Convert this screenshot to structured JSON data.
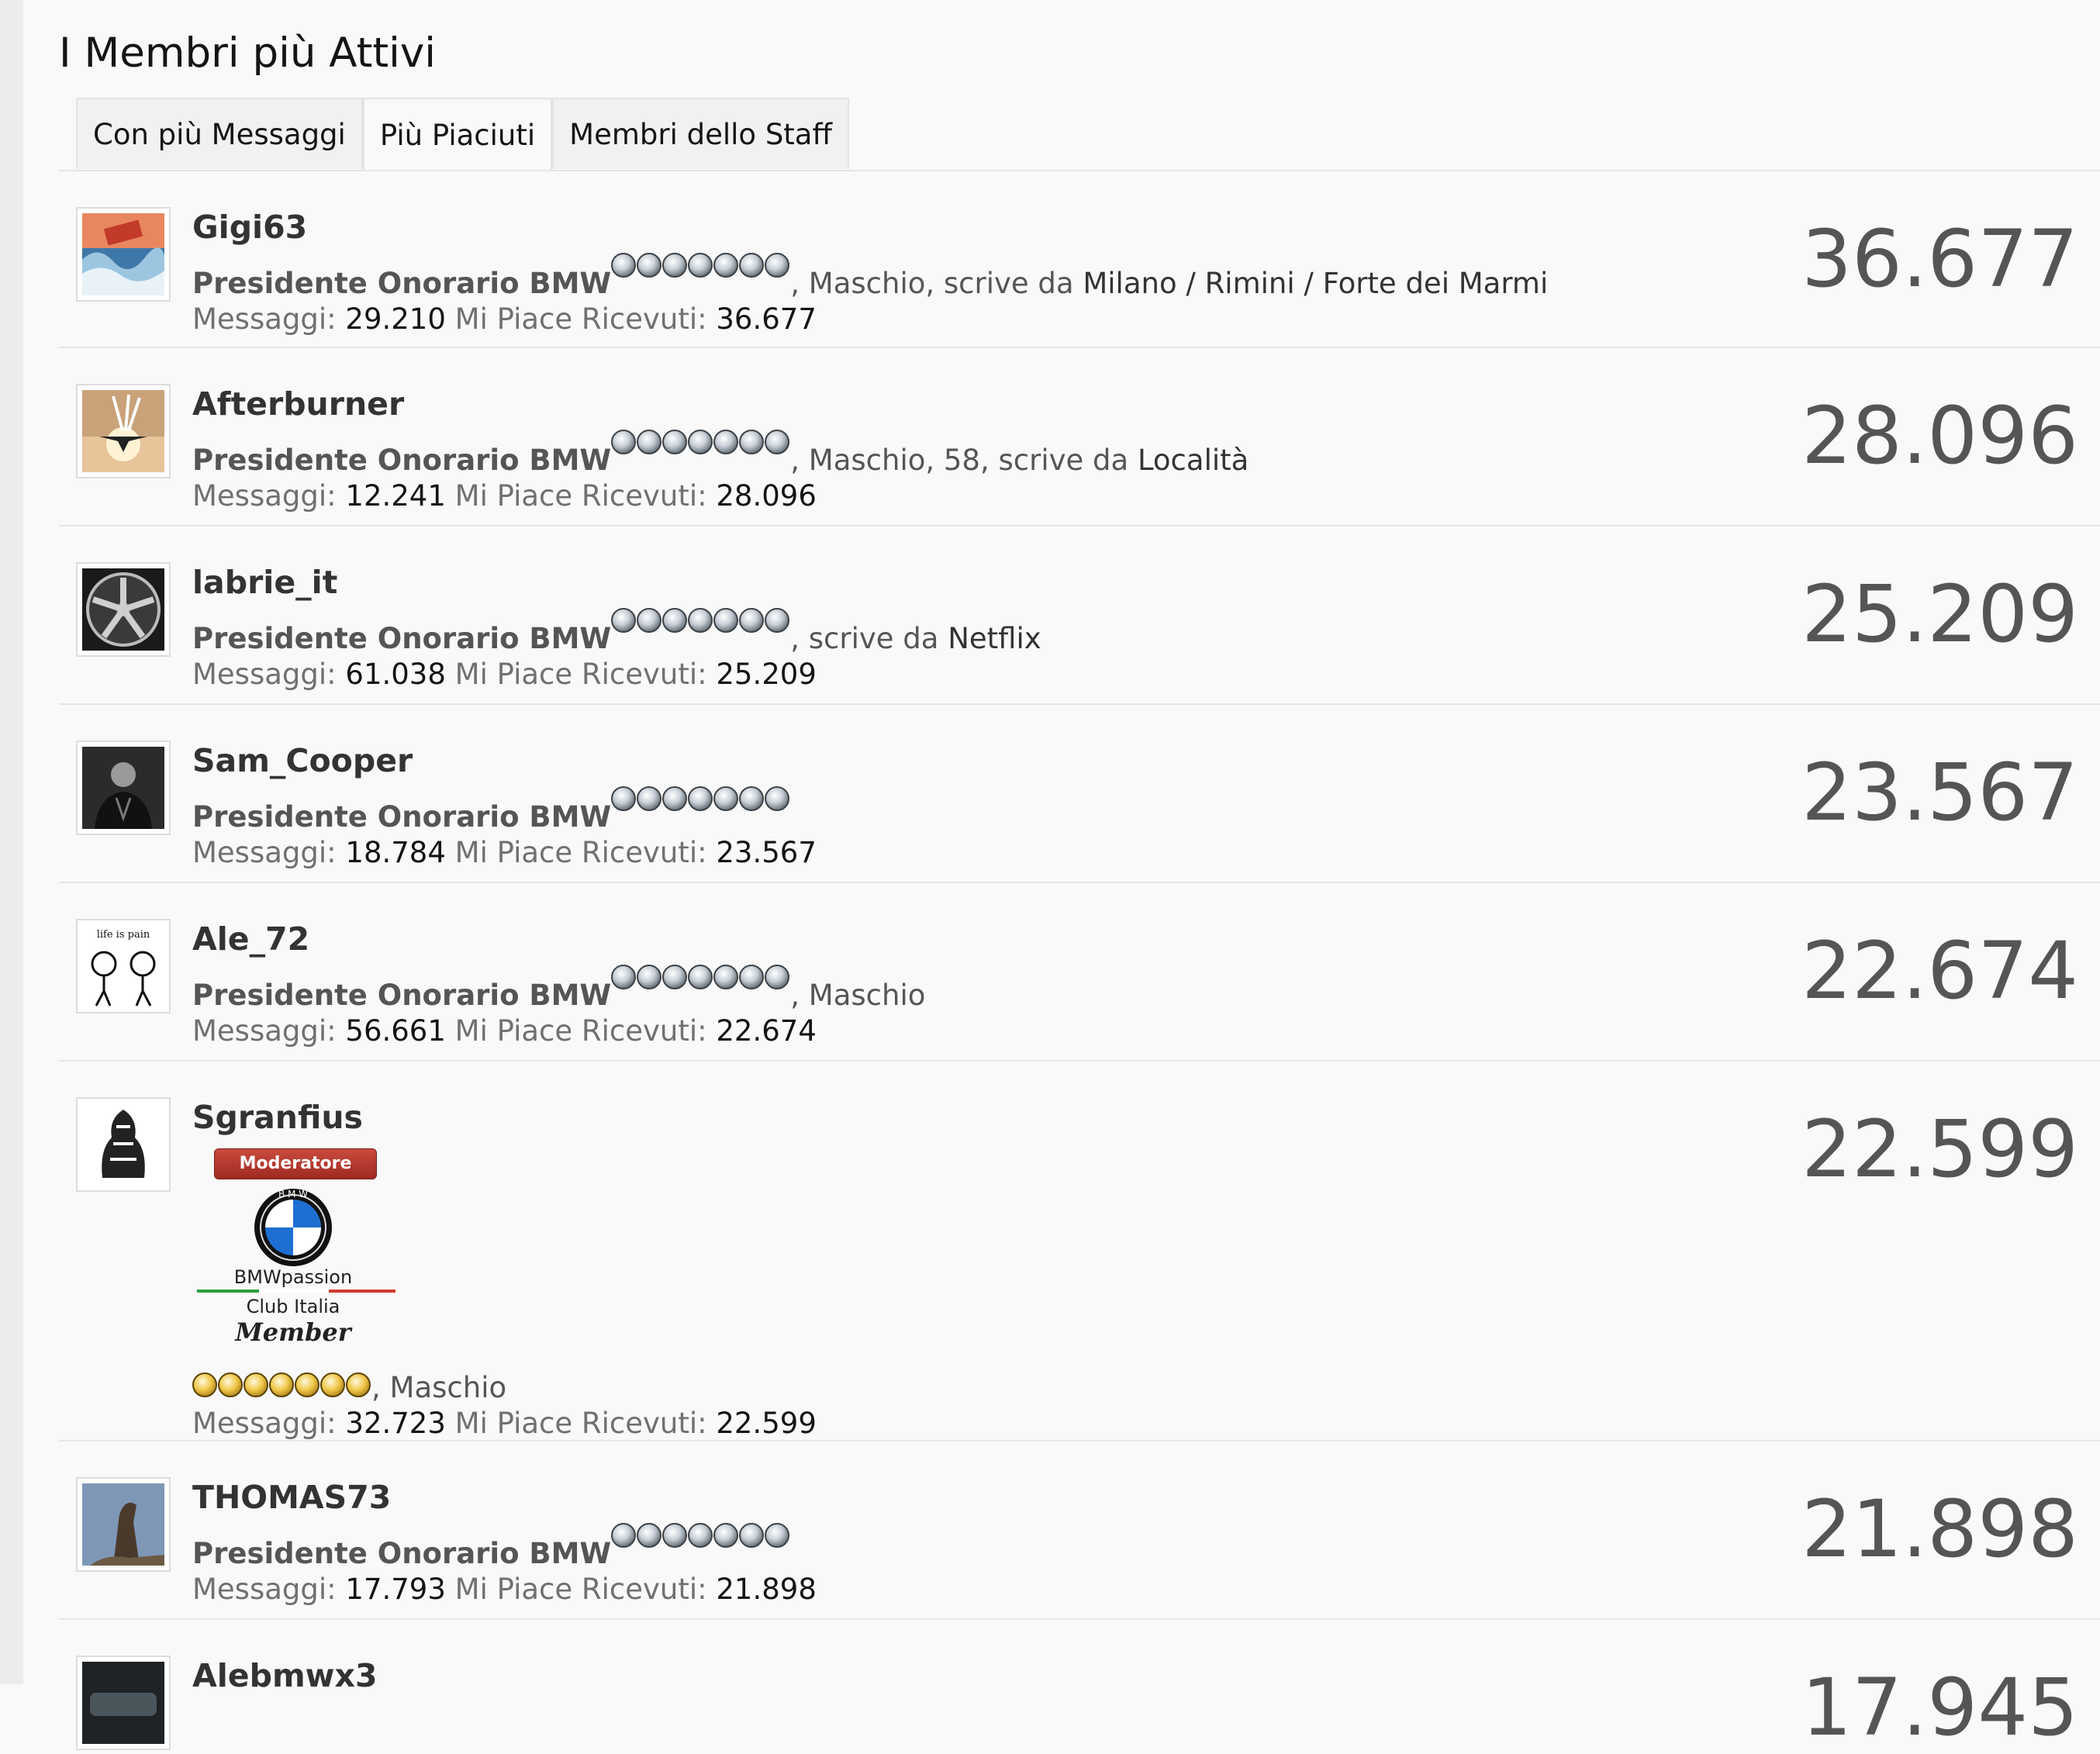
{
  "page": {
    "title": "I Membri più Attivi"
  },
  "tabs": [
    {
      "label": "Con più Messaggi"
    },
    {
      "label": "Più Piaciuti"
    },
    {
      "label": "Membri dello Staff"
    }
  ],
  "labels": {
    "messages": "Messaggi:",
    "likes": "Mi Piace Ricevuti:",
    "writes_from": ", scrive da "
  },
  "members": [
    {
      "username": "Gigi63",
      "rank": "Presidente Onorario BMW",
      "gender": ", Maschio",
      "age": "",
      "location": "Milano / Rimini / Forte dei Marmi",
      "messages": "29.210",
      "likes": "36.677",
      "score": "36.677",
      "avatar": "wave-avatar-icon"
    },
    {
      "username": "Afterburner",
      "rank": "Presidente Onorario BMW",
      "gender": ", Maschio",
      "age": ", 58",
      "location": "Località",
      "messages": "12.241",
      "likes": "28.096",
      "score": "28.096",
      "avatar": "jet-avatar-icon"
    },
    {
      "username": "labrie_it",
      "rank": "Presidente Onorario BMW",
      "gender": "",
      "age": "",
      "location": "Netflix",
      "messages": "61.038",
      "likes": "25.209",
      "score": "25.209",
      "avatar": "wheel-avatar-icon"
    },
    {
      "username": "Sam_Cooper",
      "rank": "Presidente Onorario BMW",
      "gender": "",
      "age": "",
      "location": "",
      "messages": "18.784",
      "likes": "23.567",
      "score": "23.567",
      "avatar": "officer-avatar-icon"
    },
    {
      "username": "Ale_72",
      "rank": "Presidente Onorario BMW",
      "gender": ", Maschio",
      "age": "",
      "location": "",
      "messages": "56.661",
      "likes": "22.674",
      "score": "22.674",
      "avatar": "life-is-pain-avatar-icon",
      "avatar_text": "life is pain"
    },
    {
      "username": "Sgranfius",
      "badge": "Moderatore",
      "club": {
        "name": "BMWpassion",
        "subtitle": "Club Italia",
        "member": "Member",
        "roundel": "B M W"
      },
      "gender": ", Maschio",
      "messages": "32.723",
      "likes": "22.599",
      "score": "22.599",
      "avatar": "tribal-avatar-icon"
    },
    {
      "username": "THOMAS73",
      "rank": "Presidente Onorario BMW",
      "gender": "",
      "age": "",
      "location": "",
      "messages": "17.793",
      "likes": "21.898",
      "score": "21.898",
      "avatar": "statue-avatar-icon"
    },
    {
      "username": "Alebmwx3",
      "score": "17.945",
      "avatar": "car-avatar-icon"
    }
  ],
  "colors": {
    "background": "#f9f9f9",
    "score": "#555555",
    "moderator_badge": "#b43a2e",
    "rank_bulb": "#9aa3ab",
    "gold_bulb": "#e0b43a"
  }
}
